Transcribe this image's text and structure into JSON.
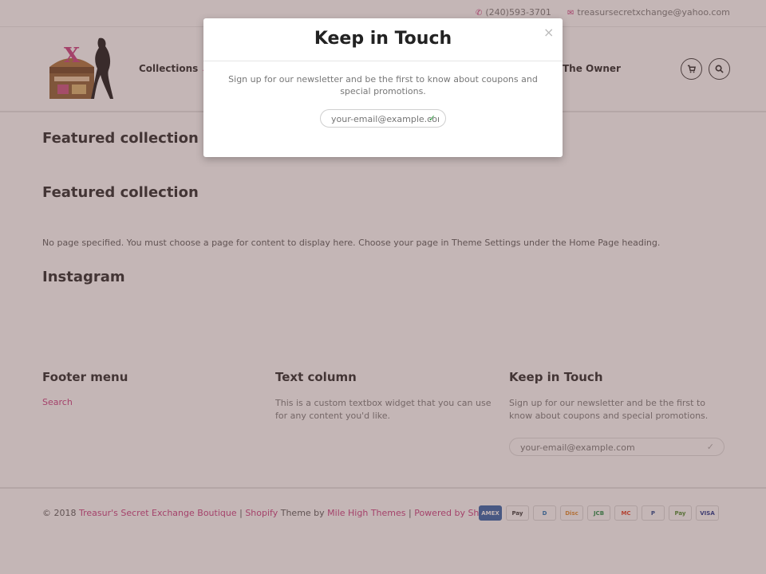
{
  "topbar": {
    "phone": "(240)593-3701",
    "email": "treasursecretxchange@yahoo.com"
  },
  "header": {
    "nav": [
      {
        "label": "Collections"
      },
      {
        "label": "The Owner"
      }
    ]
  },
  "main": {
    "sections": [
      {
        "title": "Featured collection"
      },
      {
        "title": "Featured collection"
      },
      {
        "title": "Instagram"
      }
    ],
    "page_note": "No page specified. You must choose a page for content to display here. Choose your page in Theme Settings under the Home Page heading."
  },
  "footer": {
    "menu_title": "Footer menu",
    "menu_link": "Search",
    "text_title": "Text column",
    "text_body": "This is a custom textbox widget that you can use for any content you'd like.",
    "newsletter_title": "Keep in Touch",
    "newsletter_body": "Sign up for our newsletter and be the first to know about coupons and special promotions.",
    "email_placeholder": "your-email@example.com"
  },
  "bottombar": {
    "copyright_prefix": "© 2018 ",
    "store_name": "Treasur's Secret Exchange Boutique",
    "sep1": " | ",
    "shopify": "Shopify",
    "theme_by": " Theme by ",
    "theme_author": "Mile High Themes",
    "sep2": " | ",
    "powered": "Powered by Shopify",
    "payments": [
      "AMEX",
      "Pay",
      "D",
      "Disc",
      "JCB",
      "MC",
      "P",
      "Pay",
      "VISA"
    ]
  },
  "modal": {
    "title": "Keep in Touch",
    "close": "×",
    "text": "Sign up for our newsletter and be the first to know about coupons and special promotions.",
    "email_placeholder": "your-email@example.com"
  },
  "colors": {
    "accent": "#c9377d",
    "overlay": "#735050"
  },
  "icons": [
    "phone-icon",
    "envelope-icon",
    "chevron-down-icon",
    "cart-icon",
    "search-icon",
    "check-icon",
    "close-icon"
  ]
}
